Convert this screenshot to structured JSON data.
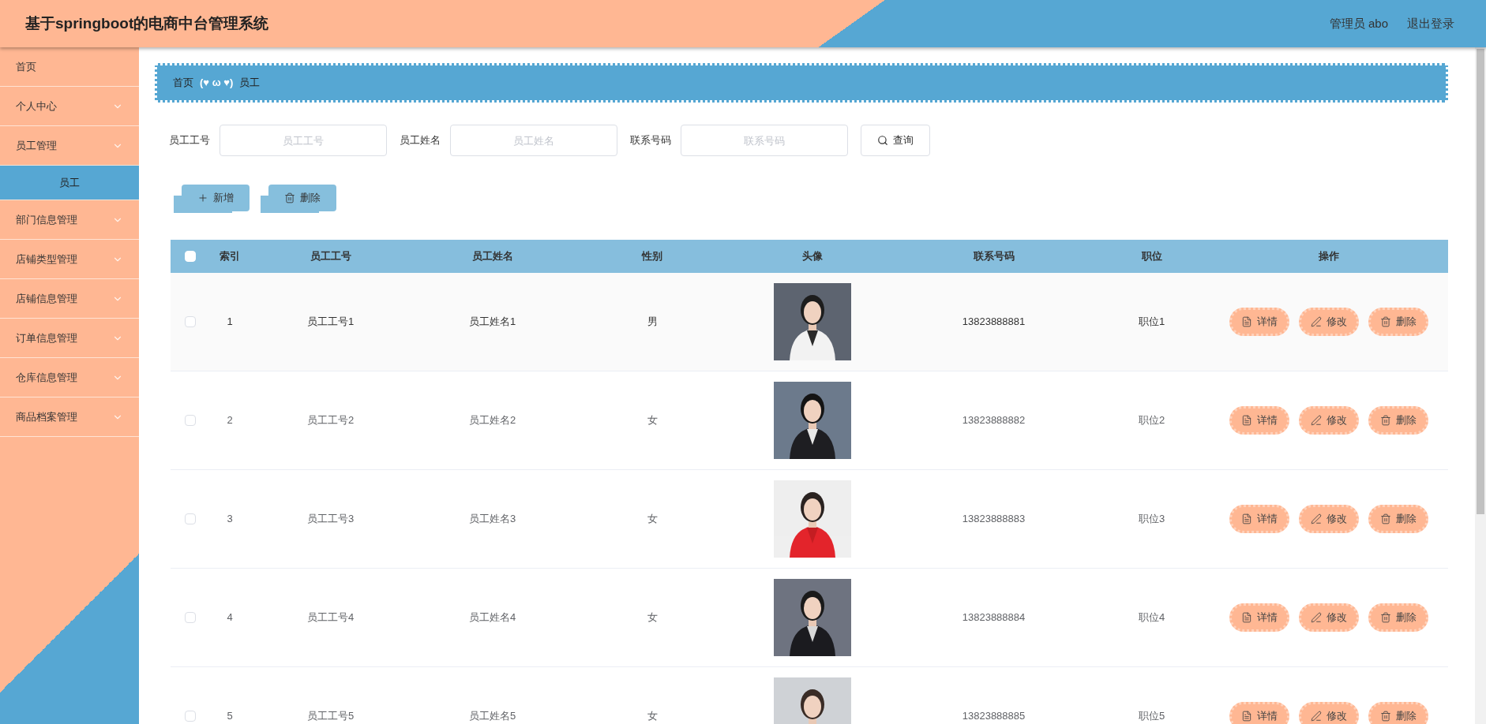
{
  "header": {
    "title": "基于springboot的电商中台管理系统",
    "user": "管理员 abo",
    "logout": "退出登录"
  },
  "sidebar": {
    "items": [
      {
        "label": "首页",
        "has_children": false
      },
      {
        "label": "个人中心",
        "has_children": true
      },
      {
        "label": "员工管理",
        "has_children": true,
        "children": [
          {
            "label": "员工",
            "selected": true
          }
        ]
      },
      {
        "label": "部门信息管理",
        "has_children": true
      },
      {
        "label": "店铺类型管理",
        "has_children": true
      },
      {
        "label": "店铺信息管理",
        "has_children": true
      },
      {
        "label": "订单信息管理",
        "has_children": true
      },
      {
        "label": "仓库信息管理",
        "has_children": true
      },
      {
        "label": "商品档案管理",
        "has_children": true
      }
    ]
  },
  "breadcrumb": {
    "items": [
      "首页",
      "员工"
    ],
    "separator": "(♥ ω ♥)"
  },
  "search": {
    "fields": [
      {
        "label": "员工工号",
        "placeholder": "员工工号"
      },
      {
        "label": "员工姓名",
        "placeholder": "员工姓名"
      },
      {
        "label": "联系号码",
        "placeholder": "联系号码"
      }
    ],
    "button": "查询"
  },
  "toolbar": [
    {
      "kind": "add",
      "label": "新增"
    },
    {
      "kind": "delete",
      "label": "删除"
    }
  ],
  "table": {
    "select_all": {
      "checked": false
    },
    "columns": [
      "索引",
      "员工工号",
      "员工姓名",
      "性别",
      "头像",
      "联系号码",
      "职位",
      "操作"
    ],
    "rows": [
      {
        "index": "1",
        "id": "员工工号1",
        "name": "员工姓名1",
        "gender": "男",
        "phone": "13823888881",
        "position": "职位1",
        "checked": false,
        "highlighted": true,
        "actions": [
          {
            "kind": "detail",
            "label": "详情"
          },
          {
            "kind": "edit",
            "label": "修改"
          },
          {
            "kind": "delete",
            "label": "删除"
          }
        ]
      },
      {
        "index": "2",
        "id": "员工工号2",
        "name": "员工姓名2",
        "gender": "女",
        "phone": "13823888882",
        "position": "职位2",
        "checked": false,
        "highlighted": false,
        "actions": [
          {
            "kind": "detail",
            "label": "详情"
          },
          {
            "kind": "edit",
            "label": "修改"
          },
          {
            "kind": "delete",
            "label": "删除"
          }
        ]
      },
      {
        "index": "3",
        "id": "员工工号3",
        "name": "员工姓名3",
        "gender": "女",
        "phone": "13823888883",
        "position": "职位3",
        "checked": false,
        "highlighted": false,
        "actions": [
          {
            "kind": "detail",
            "label": "详情"
          },
          {
            "kind": "edit",
            "label": "修改"
          },
          {
            "kind": "delete",
            "label": "删除"
          }
        ]
      },
      {
        "index": "4",
        "id": "员工工号4",
        "name": "员工姓名4",
        "gender": "女",
        "phone": "13823888884",
        "position": "职位4",
        "checked": false,
        "highlighted": false,
        "actions": [
          {
            "kind": "detail",
            "label": "详情"
          },
          {
            "kind": "edit",
            "label": "修改"
          },
          {
            "kind": "delete",
            "label": "删除"
          }
        ]
      },
      {
        "index": "5",
        "id": "员工工号5",
        "name": "员工姓名5",
        "gender": "女",
        "phone": "13823888885",
        "position": "职位5",
        "checked": false,
        "highlighted": false,
        "actions": [
          {
            "kind": "detail",
            "label": "详情"
          },
          {
            "kind": "edit",
            "label": "修改"
          },
          {
            "kind": "delete",
            "label": "删除"
          }
        ]
      }
    ]
  }
}
